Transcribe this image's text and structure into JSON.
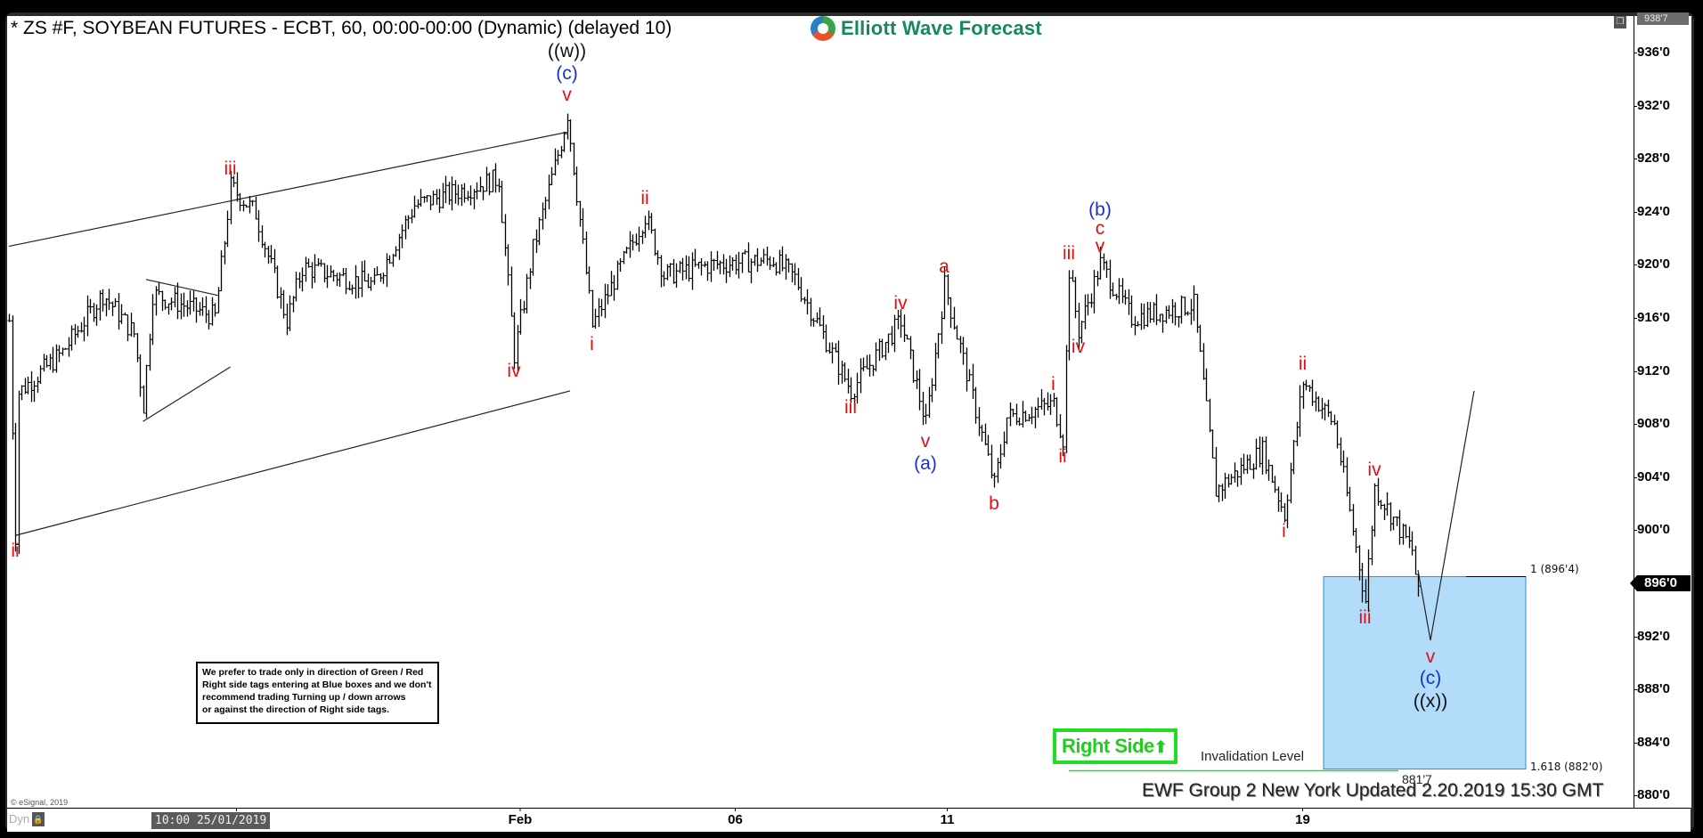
{
  "window": {
    "title": "* ZS #F, SOYBEAN FUTURES - ECBT, 60, 00:00-00:00 (Dynamic) (delayed 10)",
    "logo_text": "Elliott Wave Forecast",
    "restore_icon": "restore-window-icon",
    "top_price_tag": "938'7",
    "current_price_tag": "896'0",
    "copyright": "© eSignal, 2019",
    "dyn_label": "Dyn",
    "lock_icon": "lock-icon",
    "crosshair_date": "10:00 25/01/2019",
    "updated_text": "EWF Group 2 New York Updated 2.20.2019 15:30 GMT"
  },
  "note": {
    "line1": "We prefer to trade only in direction of Green / Red",
    "line2": "Right side tags entering at Blue boxes and we don't",
    "line3": "recommend trading Turning up / down arrows",
    "line4": "or against the direction of Right side tags."
  },
  "right_side_tag": {
    "label": "Right Side",
    "arrow": "⬆",
    "color": "#22dd22"
  },
  "invalidation": {
    "label": "Invalidation Level",
    "value_label": "881'7",
    "price": 881.875
  },
  "blue_box": {
    "top_label": "1 (896'4)",
    "top_price": 896.5,
    "bottom_label": "1.618 (882'0)",
    "bottom_price": 882.0,
    "color": "#b3dcfa"
  },
  "chart_data": {
    "type": "ohlc",
    "title": "ZS #F, SOYBEAN FUTURES - ECBT, 60",
    "xlabel": "",
    "ylabel": "",
    "ylim": [
      879,
      938.9
    ],
    "y_ticks": [
      {
        "value": 936,
        "label": "936'0"
      },
      {
        "value": 932,
        "label": "932'0"
      },
      {
        "value": 928,
        "label": "928'0"
      },
      {
        "value": 924,
        "label": "924'0"
      },
      {
        "value": 920,
        "label": "920'0"
      },
      {
        "value": 916,
        "label": "916'0"
      },
      {
        "value": 912,
        "label": "912'0"
      },
      {
        "value": 908,
        "label": "908'0"
      },
      {
        "value": 904,
        "label": "904'0"
      },
      {
        "value": 900,
        "label": "900'0"
      },
      {
        "value": 896,
        "label": "896'0"
      },
      {
        "value": 892,
        "label": "892'0"
      },
      {
        "value": 888,
        "label": "888'0"
      },
      {
        "value": 884,
        "label": "884'0"
      },
      {
        "value": 880,
        "label": "880'0"
      }
    ],
    "x_ticks": [
      {
        "bar": 73,
        "label": ""
      },
      {
        "bar": 164,
        "label": "Feb"
      },
      {
        "bar": 233,
        "label": "06"
      },
      {
        "bar": 301,
        "label": "11"
      },
      {
        "bar": 415,
        "label": "19"
      }
    ],
    "xlim_bars": [
      0,
      520
    ],
    "price_path": [
      [
        0,
        915.8
      ],
      [
        2,
        899.6
      ],
      [
        3,
        910.4
      ],
      [
        17,
        913.4
      ],
      [
        30,
        917.8
      ],
      [
        40,
        914.8
      ],
      [
        43,
        909.4
      ],
      [
        46,
        917.8
      ],
      [
        66,
        916.1
      ],
      [
        69,
        921.8
      ],
      [
        71,
        925.9
      ],
      [
        79,
        923.9
      ],
      [
        89,
        915.8
      ],
      [
        94,
        919.8
      ],
      [
        117,
        918.5
      ],
      [
        130,
        924.5
      ],
      [
        157,
        926.5
      ],
      [
        162,
        913.2
      ],
      [
        168,
        921.2
      ],
      [
        177,
        929.2
      ],
      [
        179,
        931.4
      ],
      [
        187,
        915.4
      ],
      [
        204,
        923.7
      ],
      [
        210,
        919.2
      ],
      [
        225,
        920.0
      ],
      [
        245,
        920.4
      ],
      [
        252,
        919.0
      ],
      [
        270,
        910.5
      ],
      [
        286,
        915.8
      ],
      [
        294,
        908.0
      ],
      [
        300,
        918.5
      ],
      [
        316,
        903.4
      ],
      [
        320,
        908.5
      ],
      [
        335,
        909.5
      ],
      [
        338,
        906.9
      ],
      [
        340,
        919.6
      ],
      [
        343,
        915.0
      ],
      [
        350,
        920.1
      ],
      [
        360,
        916.0
      ],
      [
        380,
        917.0
      ],
      [
        387,
        903.0
      ],
      [
        402,
        906.0
      ],
      [
        409,
        901.2
      ],
      [
        415,
        911.2
      ],
      [
        425,
        908.0
      ],
      [
        435,
        894.7
      ],
      [
        438,
        903.2
      ],
      [
        450,
        898.5
      ],
      [
        452,
        895.0
      ]
    ],
    "projection_path": [
      [
        452,
        897.0
      ],
      [
        456,
        891.7
      ],
      [
        470,
        910.5
      ]
    ],
    "channel_lines": [
      {
        "name": "upper-channel",
        "points": [
          [
            0,
            921.4
          ],
          [
            179,
            930.0
          ]
        ]
      },
      {
        "name": "lower-channel",
        "points": [
          [
            2,
            899.6
          ],
          [
            180,
            910.5
          ]
        ]
      },
      {
        "name": "triangle-upper",
        "points": [
          [
            44,
            918.9
          ],
          [
            67,
            917.7
          ]
        ]
      },
      {
        "name": "triangle-lower",
        "points": [
          [
            43,
            908.2
          ],
          [
            71,
            912.3
          ]
        ]
      }
    ],
    "wave_labels": [
      {
        "text": "ii",
        "color": "red",
        "bar": 2,
        "price": 898.4,
        "pos": "below"
      },
      {
        "text": "iii",
        "color": "red",
        "bar": 71,
        "price": 927.2,
        "pos": "above"
      },
      {
        "text": "iv",
        "color": "red",
        "bar": 162,
        "price": 912.0,
        "pos": "below"
      },
      {
        "text": "v",
        "color": "red",
        "bar": 179,
        "price": 932.8,
        "pos": "above"
      },
      {
        "text": "(c)",
        "color": "blue",
        "bar": 179,
        "price": 934.4,
        "pos": "above"
      },
      {
        "text": "((w))",
        "color": "black",
        "bar": 179,
        "price": 936.1,
        "pos": "above"
      },
      {
        "text": "i",
        "color": "red",
        "bar": 187,
        "price": 914.0,
        "pos": "below"
      },
      {
        "text": "ii",
        "color": "red",
        "bar": 204,
        "price": 925.0,
        "pos": "above"
      },
      {
        "text": "iii",
        "color": "red",
        "bar": 270,
        "price": 909.2,
        "pos": "below"
      },
      {
        "text": "iv",
        "color": "red",
        "bar": 286,
        "price": 917.1,
        "pos": "above"
      },
      {
        "text": "v",
        "color": "red",
        "bar": 294,
        "price": 906.7,
        "pos": "below"
      },
      {
        "text": "(a)",
        "color": "blue",
        "bar": 294,
        "price": 905.0,
        "pos": "below"
      },
      {
        "text": "a",
        "color": "red",
        "bar": 300,
        "price": 919.8,
        "pos": "above"
      },
      {
        "text": "b",
        "color": "red",
        "bar": 316,
        "price": 902.0,
        "pos": "below"
      },
      {
        "text": "i",
        "color": "red",
        "bar": 335,
        "price": 911.0,
        "pos": "above"
      },
      {
        "text": "ii",
        "color": "red",
        "bar": 338,
        "price": 905.5,
        "pos": "below"
      },
      {
        "text": "iii",
        "color": "red",
        "bar": 340,
        "price": 920.8,
        "pos": "above"
      },
      {
        "text": "iv",
        "color": "red",
        "bar": 343,
        "price": 913.8,
        "pos": "below"
      },
      {
        "text": "v",
        "color": "red",
        "bar": 350,
        "price": 921.4,
        "pos": "above"
      },
      {
        "text": "c",
        "color": "red",
        "bar": 350,
        "price": 922.7,
        "pos": "above"
      },
      {
        "text": "(b)",
        "color": "blue",
        "bar": 350,
        "price": 924.1,
        "pos": "above"
      },
      {
        "text": "i",
        "color": "red",
        "bar": 409,
        "price": 899.9,
        "pos": "below"
      },
      {
        "text": "ii",
        "color": "red",
        "bar": 415,
        "price": 912.5,
        "pos": "above"
      },
      {
        "text": "iii",
        "color": "red",
        "bar": 435,
        "price": 893.4,
        "pos": "below"
      },
      {
        "text": "iv",
        "color": "red",
        "bar": 438,
        "price": 904.5,
        "pos": "above"
      },
      {
        "text": "v",
        "color": "red",
        "bar": 456,
        "price": 890.4,
        "pos": "below"
      },
      {
        "text": "(c)",
        "color": "blue",
        "bar": 456,
        "price": 888.8,
        "pos": "below"
      },
      {
        "text": "((x))",
        "color": "black",
        "bar": 456,
        "price": 887.1,
        "pos": "below"
      }
    ]
  }
}
